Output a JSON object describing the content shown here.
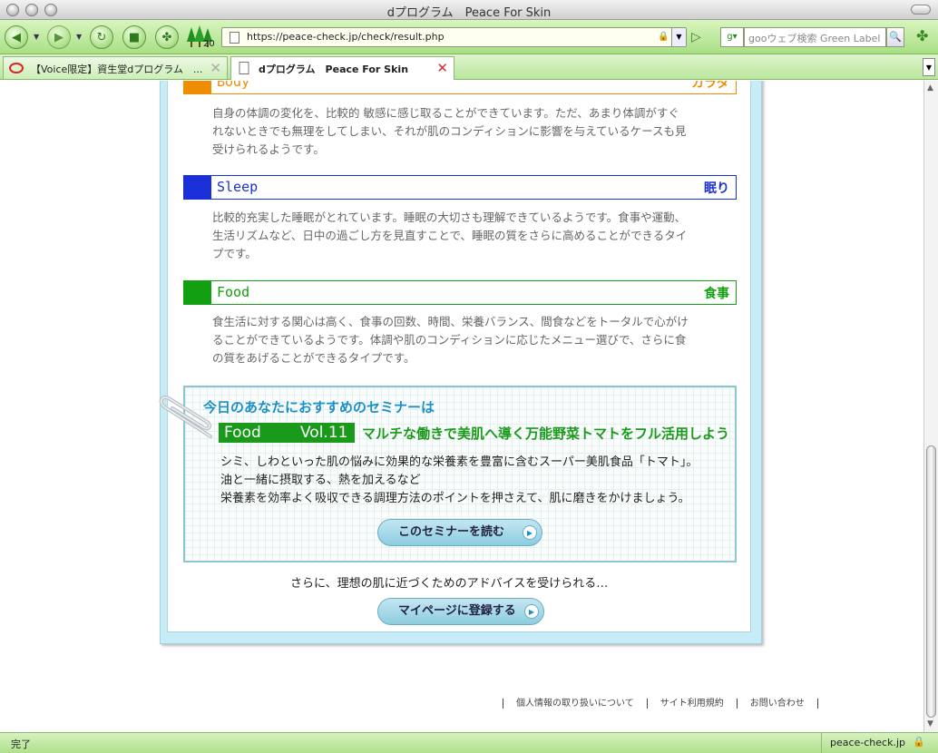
{
  "window": {
    "title": "dプログラム　Peace For Skin"
  },
  "toolbar": {
    "trees_count": "20",
    "url": "https://peace-check.jp/check/result.php",
    "search_engine": "g",
    "search_placeholder": "gooウェブ検索 Green Label"
  },
  "tabs": [
    {
      "label": "【Voice限定】資生堂dプログラム　...",
      "active": false
    },
    {
      "label": "dプログラム　Peace For Skin",
      "active": true
    }
  ],
  "sections": [
    {
      "en": "Body",
      "jp": "カラダ",
      "color": "#f08c00",
      "text": [
        "自身の体調の変化を、比較的 敏感に感じ取ることができています。ただ、あまり体調がすぐ",
        "れないときでも無理をしてしまい、それが肌のコンディションに影響を与えているケースも見",
        "受けられるようです。"
      ]
    },
    {
      "en": "Sleep",
      "jp": "眠り",
      "color": "#1a2fd8",
      "text": [
        "比較的充実した睡眠がとれています。睡眠の大切さも理解できているようです。食事や運動、",
        "生活リズムなど、日中の過ごし方を見直すことで、睡眠の質をさらに高めることができるタイ",
        "プです。"
      ]
    },
    {
      "en": "Food",
      "jp": "食事",
      "color": "#12a012",
      "text": [
        "食生活に対する関心は高く、食事の回数、時間、栄養バランス、間食などをトータルで心がけ",
        "ることができているようです。体調や肌のコンディションに応じたメニュー選びで、さらに食",
        "の質をあげることができるタイプです。"
      ]
    }
  ],
  "recommend": {
    "title": "今日のあなたにおすすめのセミナーは",
    "badge_category": "Food",
    "badge_vol": "Vol.11",
    "headline": "マルチな働きで美肌へ導く万能野菜トマトをフル活用しよう",
    "body": [
      "シミ、しわといった肌の悩みに効果的な栄養素を豊富に含むスーパー美肌食品「トマト」。",
      "油と一緒に摂取する、熱を加えるなど",
      "栄養素を効率よく吸収できる調理方法のポイントを押さえて、肌に磨きをかけましょう。"
    ],
    "button": "このセミナーを読む"
  },
  "advice": "さらに、理想の肌に近づくためのアドバイスを受けられる…",
  "register_button": "マイページに登録する",
  "footer": [
    "個人情報の取り扱いについて",
    "サイト利用規約",
    "お問い合わせ"
  ],
  "status": {
    "text": "完了",
    "site": "peace-check.jp"
  }
}
